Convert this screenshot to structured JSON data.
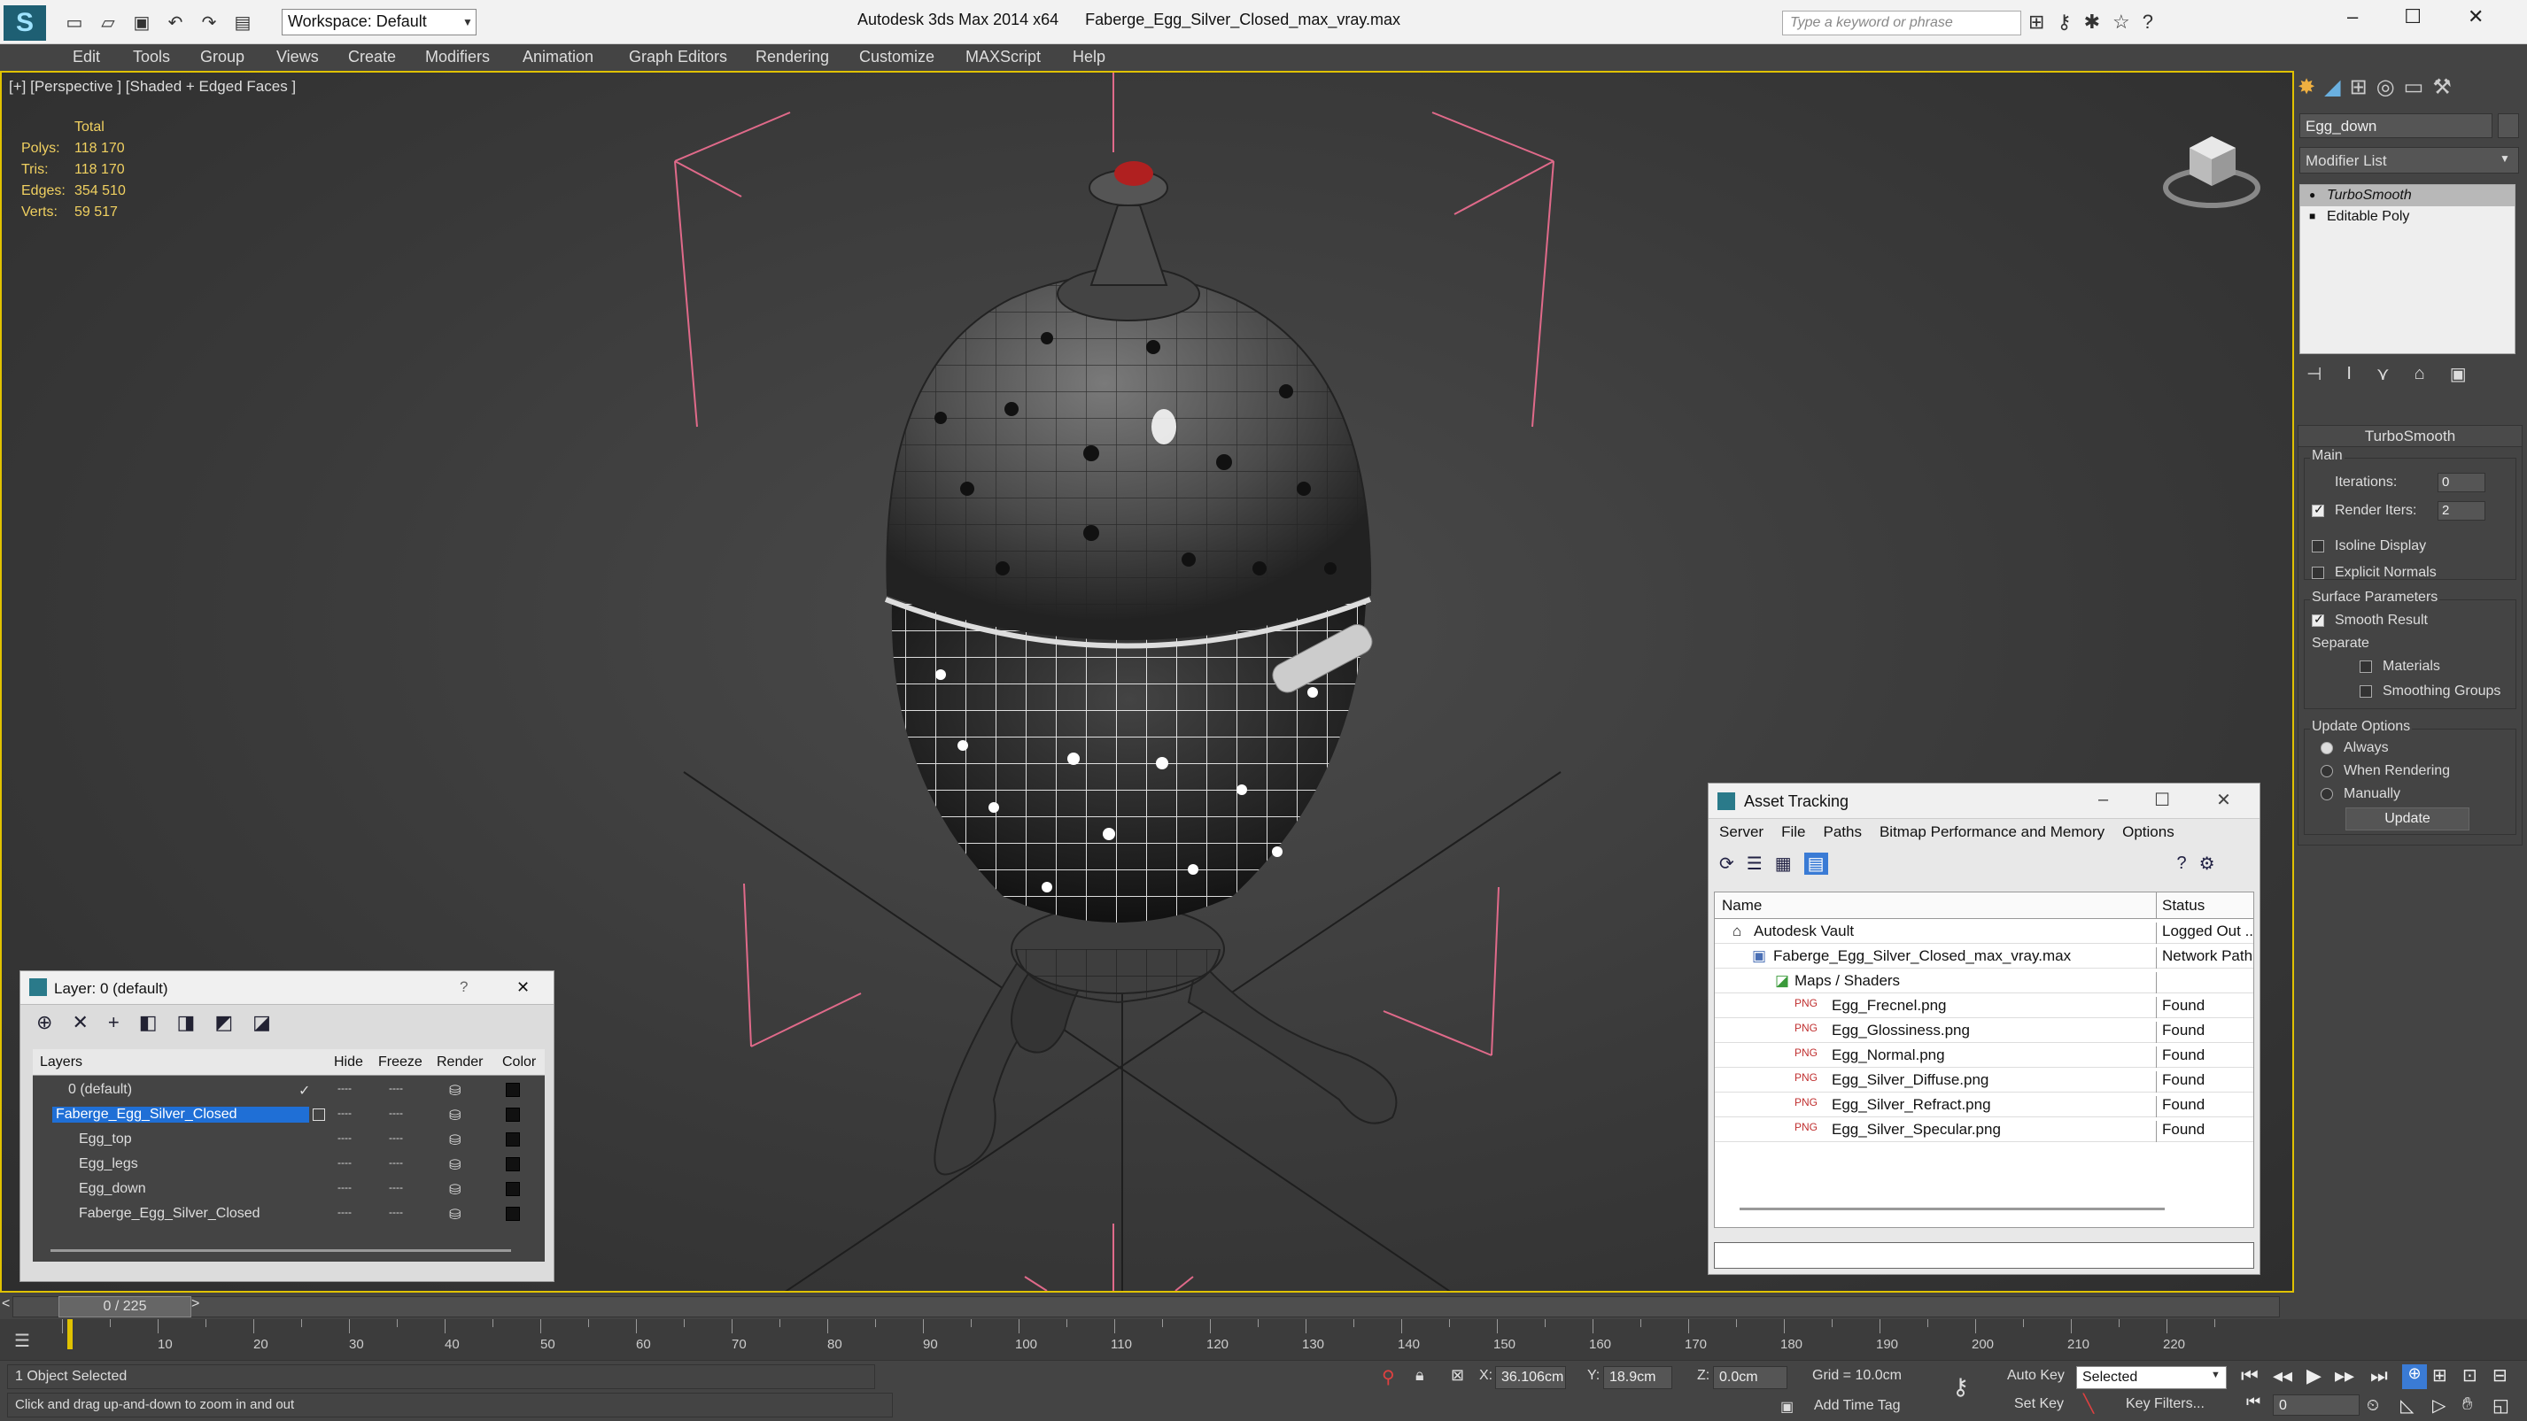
{
  "window": {
    "app_title": "Autodesk 3ds Max  2014 x64",
    "file_title": "Faberge_Egg_Silver_Closed_max_vray.max",
    "workspace": "Workspace: Default",
    "search_placeholder": "Type a keyword or phrase"
  },
  "menu": [
    "Edit",
    "Tools",
    "Group",
    "Views",
    "Create",
    "Modifiers",
    "Animation",
    "Graph Editors",
    "Rendering",
    "Customize",
    "MAXScript",
    "Help"
  ],
  "viewport": {
    "label": "[+] [Perspective ] [Shaded + Edged Faces ]",
    "stats_header": "Total",
    "stats": [
      {
        "k": "Polys:",
        "v": "118 170"
      },
      {
        "k": "Tris:",
        "v": "118 170"
      },
      {
        "k": "Edges:",
        "v": "354 510"
      },
      {
        "k": "Verts:",
        "v": "59 517"
      }
    ]
  },
  "layer_panel": {
    "title": "Layer: 0 (default)",
    "help": "?",
    "close": "✕",
    "columns": {
      "layers": "Layers",
      "hide": "Hide",
      "freeze": "Freeze",
      "render": "Render",
      "color": "Color"
    },
    "rows": [
      {
        "name": "0 (default)",
        "check": "✓",
        "dash1": "----",
        "dash2": "----"
      },
      {
        "name": "Faberge_Egg_Silver_Closed",
        "check": "",
        "dash1": "----",
        "dash2": "----"
      },
      {
        "name": "Egg_top",
        "check": "",
        "dash1": "----",
        "dash2": "----"
      },
      {
        "name": "Egg_legs",
        "check": "",
        "dash1": "----",
        "dash2": "----"
      },
      {
        "name": "Egg_down",
        "check": "",
        "dash1": "----",
        "dash2": "----"
      },
      {
        "name": "Faberge_Egg_Silver_Closed",
        "check": "",
        "dash1": "----",
        "dash2": "----"
      }
    ]
  },
  "asset_tracking": {
    "title": "Asset Tracking",
    "menu": [
      "Server",
      "File",
      "Paths",
      "Bitmap Performance and Memory",
      "Options"
    ],
    "col_name": "Name",
    "col_status": "Status",
    "rows": [
      {
        "name": "Autodesk Vault",
        "status": "Logged Out ..."
      },
      {
        "name": "Faberge_Egg_Silver_Closed_max_vray.max",
        "status": "Network Path"
      },
      {
        "name": "Maps / Shaders",
        "status": ""
      },
      {
        "name": "Egg_Frecnel.png",
        "status": "Found"
      },
      {
        "name": "Egg_Glossiness.png",
        "status": "Found"
      },
      {
        "name": "Egg_Normal.png",
        "status": "Found"
      },
      {
        "name": "Egg_Silver_Diffuse.png",
        "status": "Found"
      },
      {
        "name": "Egg_Silver_Refract.png",
        "status": "Found"
      },
      {
        "name": "Egg_Silver_Specular.png",
        "status": "Found"
      }
    ]
  },
  "command_panel": {
    "object_name": "Egg_down",
    "modifier_list": "Modifier List",
    "stack": [
      "TurboSmooth",
      "Editable Poly"
    ],
    "rollout_title": "TurboSmooth",
    "main_label": "Main",
    "iterations_label": "Iterations:",
    "iterations_value": "0",
    "render_iters_label": "Render Iters:",
    "render_iters_value": "2",
    "isoline": "Isoline Display",
    "explicit_normals": "Explicit Normals",
    "surface_params": "Surface Parameters",
    "smooth_result": "Smooth Result",
    "separate": "Separate",
    "materials": "Materials",
    "smoothing_groups": "Smoothing Groups",
    "update_options": "Update Options",
    "always": "Always",
    "when_rendering": "When Rendering",
    "manually": "Manually",
    "update_btn": "Update"
  },
  "timeline": {
    "frame": "0 / 225",
    "left_arrow": "<",
    "right_arrow": ">",
    "labels": [
      "10",
      "20",
      "30",
      "40",
      "50",
      "60",
      "70",
      "80",
      "90",
      "100",
      "110",
      "120",
      "130",
      "140",
      "150",
      "160",
      "170",
      "180",
      "190",
      "200",
      "210",
      "220"
    ]
  },
  "status": {
    "selected": "1 Object Selected",
    "hint": "Click and drag up-and-down to zoom in and out",
    "x_label": "X:",
    "x": "36.106cm",
    "y_label": "Y:",
    "y": "18.9cm",
    "z_label": "Z:",
    "z": "0.0cm",
    "grid": "Grid = 10.0cm",
    "add_time_tag": "Add Time Tag",
    "auto_key": "Auto Key",
    "set_key": "Set Key",
    "selected_dropdown": "Selected",
    "key_filters": "Key Filters...",
    "frame_value": "0"
  },
  "colors": {
    "accent": "#e0c200",
    "selection": "#1f6fd6",
    "stats": "#f0d060"
  }
}
